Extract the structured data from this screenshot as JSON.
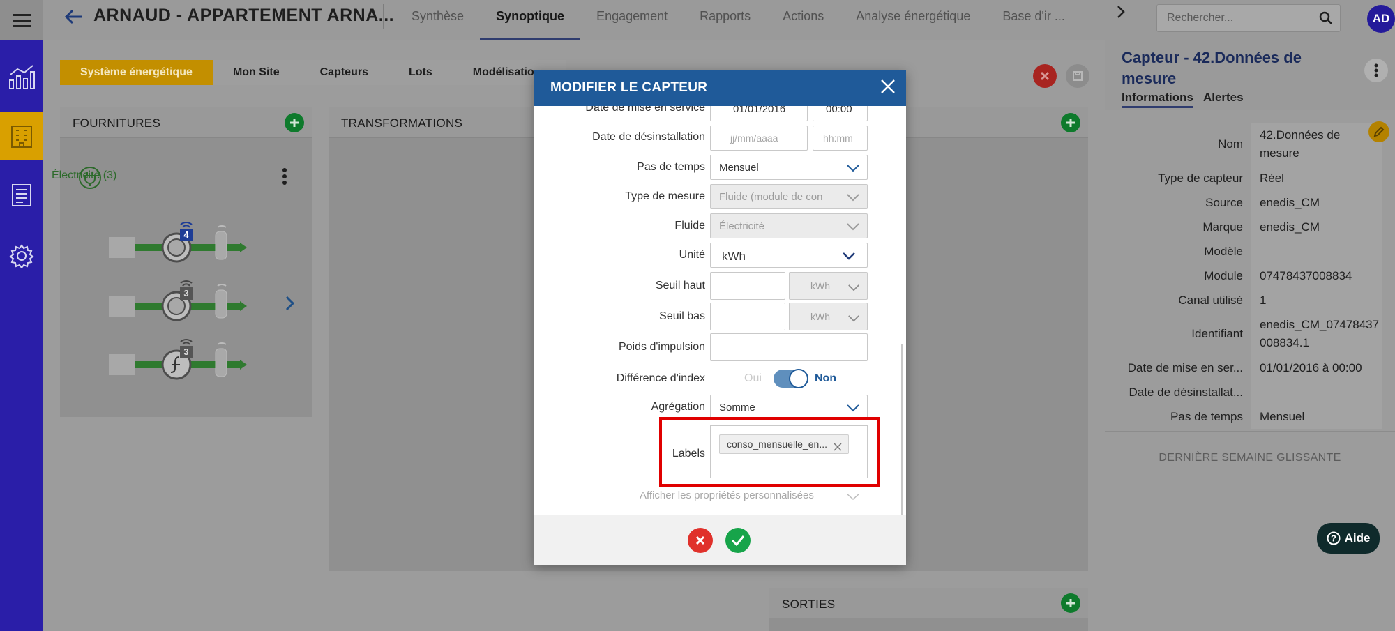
{
  "header": {
    "title": "ARNAUD - APPARTEMENT ARNA...",
    "tabs": [
      {
        "label": "Synthèse"
      },
      {
        "label": "Synoptique"
      },
      {
        "label": "Engagement"
      },
      {
        "label": "Rapports"
      },
      {
        "label": "Actions"
      },
      {
        "label": "Analyse énergétique"
      },
      {
        "label": "Base d'ir ..."
      }
    ],
    "search_placeholder": "Rechercher...",
    "avatar": "AD"
  },
  "subtabs": [
    {
      "label": "Système énergétique"
    },
    {
      "label": "Mon Site"
    },
    {
      "label": "Capteurs"
    },
    {
      "label": "Lots"
    },
    {
      "label": "Modélisatio"
    }
  ],
  "panels": {
    "fournitures": "FOURNITURES",
    "transformations": "TRANSFORMATIONS",
    "sorties": "SORTIES",
    "electricite": "Électricité (3)",
    "meters": [
      {
        "badge": "4"
      },
      {
        "badge": "3"
      },
      {
        "badge": "3"
      }
    ]
  },
  "modal": {
    "title": "MODIFIER LE CAPTEUR",
    "date_mise_service_label": "Date de mise en service",
    "date_mise_service_date": "01/01/2016",
    "date_mise_service_time": "00:00",
    "date_desinstallation_label": "Date de désinstallation",
    "date_placeholder": "jj/mm/aaaa",
    "time_placeholder": "hh:mm",
    "pas_temps_label": "Pas de temps",
    "pas_temps_value": "Mensuel",
    "type_mesure_label": "Type de mesure",
    "type_mesure_value": "Fluide (module de con",
    "fluide_label": "Fluide",
    "fluide_value": "Électricité",
    "unite_label": "Unité",
    "unite_value": "kWh",
    "seuil_haut_label": "Seuil haut",
    "seuil_bas_label": "Seuil bas",
    "seuil_unit": "kWh",
    "poids_label": "Poids d'impulsion",
    "diff_index_label": "Différence d'index",
    "toggle_oui": "Oui",
    "toggle_non": "Non",
    "agregation_label": "Agrégation",
    "agregation_value": "Somme",
    "labels_label": "Labels",
    "label_chip": "conso_mensuelle_en...",
    "props_link": "Afficher les propriétés personnalisées"
  },
  "sensor": {
    "title": "Capteur - 42.Données de mesure",
    "tabs": [
      {
        "label": "Informations"
      },
      {
        "label": "Alertes"
      }
    ],
    "rows": [
      {
        "k": "Nom",
        "v": "42.Données de mesure"
      },
      {
        "k": "Type de capteur",
        "v": "Réel"
      },
      {
        "k": "Source",
        "v": "enedis_CM"
      },
      {
        "k": "Marque",
        "v": "enedis_CM"
      },
      {
        "k": "Modèle",
        "v": ""
      },
      {
        "k": "Module",
        "v": "07478437008834"
      },
      {
        "k": "Canal utilisé",
        "v": "1"
      },
      {
        "k": "Identifiant",
        "v": "enedis_CM_07478437008834.1"
      },
      {
        "k": "Date de mise en ser...",
        "v": "01/01/2016 à 00:00"
      },
      {
        "k": "Date de désinstallat...",
        "v": ""
      },
      {
        "k": "Pas de temps",
        "v": "Mensuel"
      }
    ],
    "week_label": "DERNIÈRE SEMAINE GLISSANTE"
  },
  "help": {
    "label": "Aide"
  }
}
